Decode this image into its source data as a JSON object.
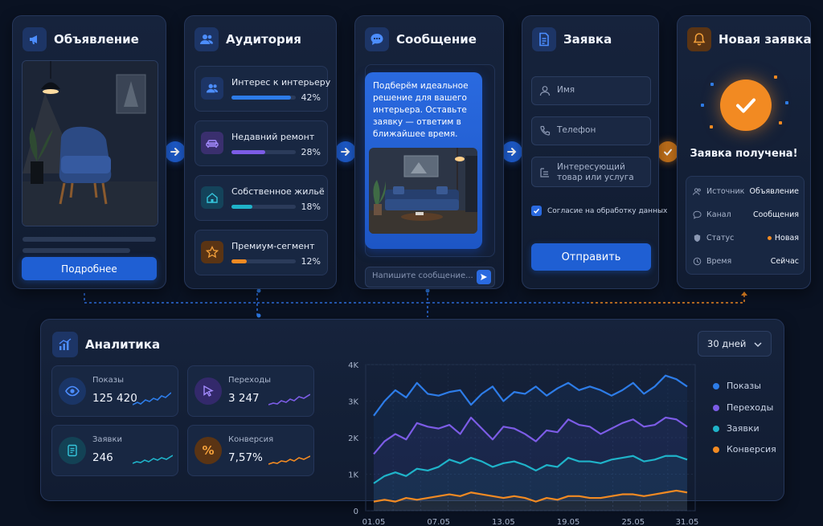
{
  "ad": {
    "title": "Объявление",
    "button_label": "Подробнее"
  },
  "audience": {
    "title": "Аудитория",
    "items": [
      {
        "label": "Интерес к интерьеру",
        "pct": "42%",
        "value": 0.42,
        "color": "#2d7ce8",
        "icon": "users-icon"
      },
      {
        "label": "Недавний ремонт",
        "pct": "28%",
        "value": 0.28,
        "color": "#7c5ce6",
        "icon": "sofa-icon"
      },
      {
        "label": "Собственное жильё",
        "pct": "18%",
        "value": 0.18,
        "color": "#1fb3c9",
        "icon": "home-icon"
      },
      {
        "label": "Премиум-сегмент",
        "pct": "12%",
        "value": 0.12,
        "color": "#f28a22",
        "icon": "star-icon"
      }
    ]
  },
  "message": {
    "title": "Сообщение",
    "bubble_text": "Подберём идеальное решение для вашего интерьера. Оставьте заявку — ответим в ближайшее время.",
    "input_placeholder": "Напишите сообщение..."
  },
  "request": {
    "title": "Заявка",
    "fields": [
      {
        "placeholder": "Имя",
        "icon": "user-icon"
      },
      {
        "placeholder": "Телефон",
        "icon": "phone-icon"
      },
      {
        "placeholder": "Интересующий товар или услуга",
        "icon": "list-icon"
      }
    ],
    "consent_label": "Согласие на обработку данных",
    "consent_checked": true,
    "submit_label": "Отправить"
  },
  "new_request": {
    "title": "Новая заявка",
    "received_label": "Заявка получена!",
    "rows": [
      {
        "key": "Источник",
        "value": "Объявление",
        "icon": "users-icon"
      },
      {
        "key": "Канал",
        "value": "Сообщения",
        "icon": "chat-icon"
      },
      {
        "key": "Статус",
        "value": "Новая",
        "icon": "shield-icon",
        "status_color": "#f28a22"
      },
      {
        "key": "Время",
        "value": "Сейчас",
        "icon": "clock-icon"
      }
    ]
  },
  "analytics": {
    "title": "Аналитика",
    "period": "30 дней",
    "kpis": [
      {
        "label": "Показы",
        "value": "125 420",
        "color": "#2d7ce8",
        "icon": "eye-icon"
      },
      {
        "label": "Переходы",
        "value": "3 247",
        "color": "#7c5ce6",
        "icon": "cursor-icon"
      },
      {
        "label": "Заявки",
        "value": "246",
        "color": "#1fb3c9",
        "icon": "document-icon"
      },
      {
        "label": "Конверсия",
        "value": "7,57%",
        "color": "#f28a22",
        "icon": "percent-icon"
      }
    ]
  },
  "chart_data": {
    "type": "line",
    "x": [
      "01.05",
      "07.05",
      "13.05",
      "19.05",
      "25.05",
      "31.05"
    ],
    "yticks": [
      "0",
      "1K",
      "2K",
      "3K",
      "4K"
    ],
    "ylim": [
      0,
      4000
    ],
    "legend_position": "right",
    "series": [
      {
        "name": "Показы",
        "color": "#2d7ce8",
        "values": [
          2600,
          3000,
          3300,
          3100,
          3500,
          3200,
          3150,
          3250,
          3300,
          2900,
          3200,
          3400,
          3000,
          3250,
          3200,
          3400,
          3150,
          3350,
          3500,
          3300,
          3400,
          3300,
          3150,
          3300,
          3500,
          3200,
          3400,
          3700,
          3600,
          3400
        ]
      },
      {
        "name": "Переходы",
        "color": "#7c5ce6",
        "values": [
          1550,
          1900,
          2100,
          1950,
          2400,
          2300,
          2250,
          2350,
          2100,
          2550,
          2250,
          1950,
          2300,
          2250,
          2100,
          1900,
          2200,
          2150,
          2500,
          2350,
          2300,
          2100,
          2250,
          2400,
          2500,
          2300,
          2350,
          2550,
          2500,
          2300
        ]
      },
      {
        "name": "Заявки",
        "color": "#1fb3c9",
        "values": [
          750,
          950,
          1050,
          950,
          1150,
          1100,
          1200,
          1400,
          1300,
          1450,
          1350,
          1200,
          1300,
          1350,
          1250,
          1100,
          1250,
          1200,
          1450,
          1350,
          1350,
          1300,
          1400,
          1450,
          1500,
          1350,
          1400,
          1500,
          1500,
          1400
        ]
      },
      {
        "name": "Конверсия",
        "color": "#f28a22",
        "values": [
          250,
          300,
          250,
          350,
          300,
          350,
          400,
          450,
          400,
          500,
          450,
          400,
          350,
          400,
          350,
          250,
          350,
          300,
          400,
          400,
          350,
          350,
          400,
          450,
          450,
          400,
          450,
          500,
          550,
          500
        ]
      }
    ]
  }
}
